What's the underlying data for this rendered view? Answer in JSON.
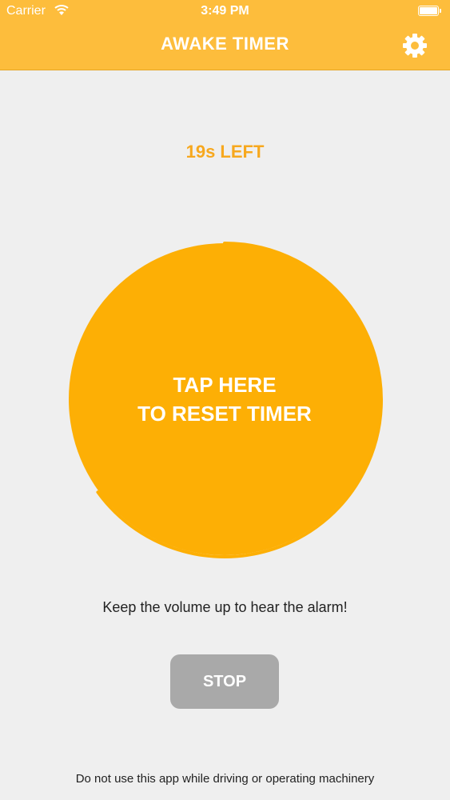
{
  "status_bar": {
    "carrier": "Carrier",
    "time": "3:49 PM",
    "wifi_icon": "wifi-icon",
    "battery_icon": "battery-icon"
  },
  "header": {
    "title": "AWAKE TIMER",
    "settings_icon": "gear-icon",
    "background_color": "#fdbd3c"
  },
  "timer": {
    "time_left": "19s LEFT",
    "reset_line1": "TAP HERE",
    "reset_line2": "TO RESET TIMER",
    "progress_fraction": 0.65,
    "accent_color": "#fdaf05"
  },
  "hint": "Keep the volume up to hear the alarm!",
  "stop_button": {
    "label": "STOP",
    "color": "#a9a9a9"
  },
  "disclaimer": "Do not use this app while driving or operating machinery"
}
